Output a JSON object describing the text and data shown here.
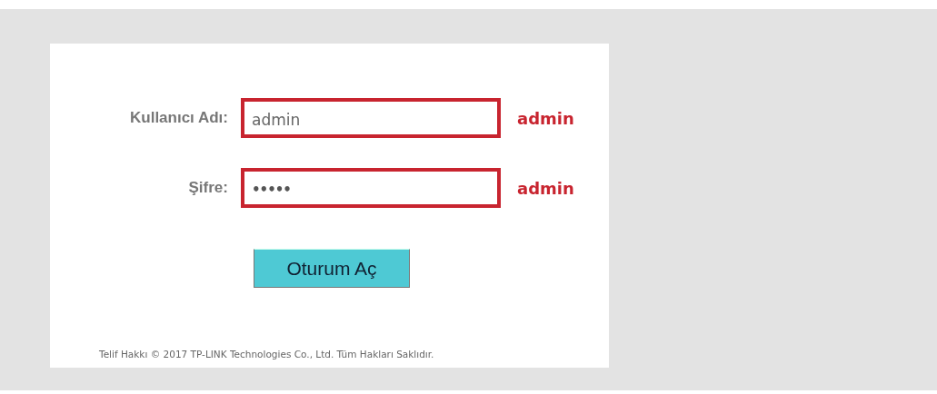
{
  "login_form": {
    "fields": [
      {
        "label": "Kullanıcı Adı:",
        "kind": "text",
        "value": "admin",
        "highlighted": true,
        "annotation": "admin"
      },
      {
        "label": "Şifre:",
        "kind": "password",
        "value": "•••••",
        "highlighted": true,
        "annotation": "admin"
      }
    ],
    "submit_button": "Oturum Aç",
    "footer": "Telif Hakkı © 2017 TP-LINK Technologies Co., Ltd. Tüm Hakları Saklıdır."
  }
}
